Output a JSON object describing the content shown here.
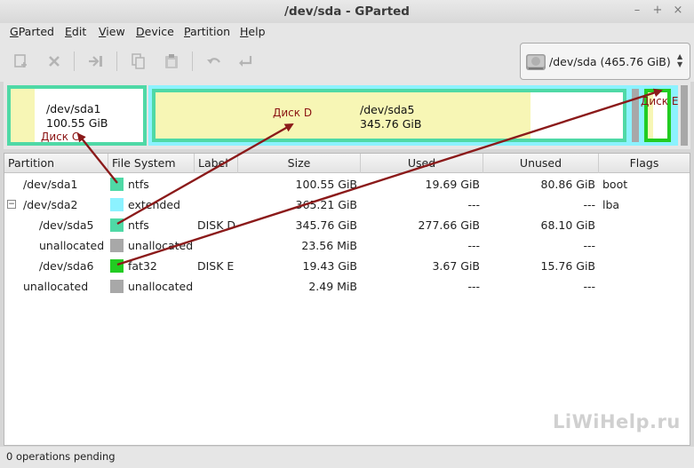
{
  "window": {
    "title": "/dev/sda - GParted",
    "controls": [
      "–",
      "+",
      "×"
    ]
  },
  "menu": [
    {
      "label": "GParted",
      "key": "G"
    },
    {
      "label": "Edit",
      "key": "E"
    },
    {
      "label": "View",
      "key": "V"
    },
    {
      "label": "Device",
      "key": "D"
    },
    {
      "label": "Partition",
      "key": "P"
    },
    {
      "label": "Help",
      "key": "H"
    }
  ],
  "toolbar": {
    "icons": [
      "new-partition-icon",
      "delete-icon",
      "resize-move-icon",
      "copy-icon",
      "paste-icon",
      "undo-icon",
      "apply-icon"
    ]
  },
  "device_selector": {
    "label": "/dev/sda  (465.76 GiB)",
    "icon": "harddisk-icon"
  },
  "disk_map": {
    "sda1": {
      "name": "/dev/sda1",
      "size": "100.55 GiB"
    },
    "sda5": {
      "name": "/dev/sda5",
      "size": "345.76 GiB"
    }
  },
  "annotations": {
    "c": "Диск C",
    "d": "Диск D",
    "e": "Диск E",
    "arrow_color": "#8b1a1a"
  },
  "table": {
    "headers": [
      "Partition",
      "File System",
      "Label",
      "Size",
      "Used",
      "Unused",
      "Flags"
    ],
    "rows": [
      {
        "partition": "/dev/sda1",
        "fs": "ntfs",
        "color": "#4fd9a6",
        "label": "",
        "size": "100.55 GiB",
        "used": "19.69 GiB",
        "unused": "80.86 GiB",
        "flags": "boot",
        "indent": 0,
        "expander": ""
      },
      {
        "partition": "/dev/sda2",
        "fs": "extended",
        "color": "#8cf2ff",
        "label": "",
        "size": "365.21 GiB",
        "used": "---",
        "unused": "---",
        "flags": "lba",
        "indent": 0,
        "expander": "−"
      },
      {
        "partition": "/dev/sda5",
        "fs": "ntfs",
        "color": "#4fd9a6",
        "label": "DISK D",
        "size": "345.76 GiB",
        "used": "277.66 GiB",
        "unused": "68.10 GiB",
        "flags": "",
        "indent": 1,
        "expander": ""
      },
      {
        "partition": "unallocated",
        "fs": "unallocated",
        "color": "#a8a8a8",
        "label": "",
        "size": "23.56 MiB",
        "used": "---",
        "unused": "---",
        "flags": "",
        "indent": 1,
        "expander": ""
      },
      {
        "partition": "/dev/sda6",
        "fs": "fat32",
        "color": "#22cc22",
        "label": "DISK E",
        "size": "19.43 GiB",
        "used": "3.67 GiB",
        "unused": "15.76 GiB",
        "flags": "",
        "indent": 1,
        "expander": ""
      },
      {
        "partition": "unallocated",
        "fs": "unallocated",
        "color": "#a8a8a8",
        "label": "",
        "size": "2.49 MiB",
        "used": "---",
        "unused": "---",
        "flags": "",
        "indent": 0,
        "expander": ""
      }
    ]
  },
  "status": {
    "text": "0 operations pending"
  },
  "watermark": "LiWiHelp.ru"
}
